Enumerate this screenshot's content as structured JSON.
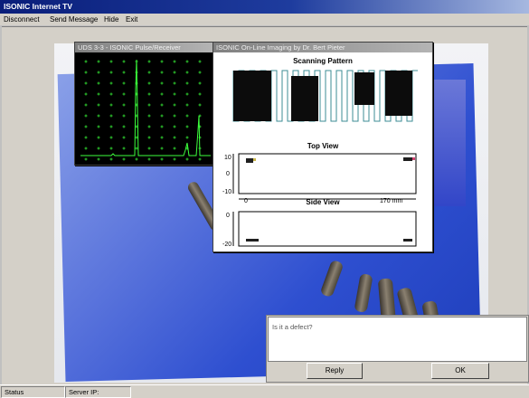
{
  "window": {
    "title": "ISONIC Internet TV"
  },
  "menu": [
    {
      "label": "Disconnect"
    },
    {
      "label": "Send Message"
    },
    {
      "label": "Hide"
    },
    {
      "label": "Exit"
    }
  ],
  "pulse_window": {
    "title": "UDS 3-3 - ISONIC Pulse/Receiver"
  },
  "imaging_window": {
    "title": "ISONIC On-Line Imaging by Dr. Bert Pieter",
    "scanning_pattern_label": "Scanning Pattern",
    "top_view_label": "Top View",
    "side_view_label": "Side View",
    "top_view_ticks": [
      "10",
      "0",
      "-10"
    ],
    "side_axis": {
      "start": "0",
      "end": "170 mm"
    },
    "side_view_ticks": [
      "0",
      "-20"
    ]
  },
  "chat": {
    "message": "Is it a defect?",
    "reply_label": "Reply",
    "ok_label": "OK"
  },
  "status_bar": {
    "status_label": "Status",
    "server_label": "Server IP:"
  },
  "colors": {
    "title_bar": "#0a1e7a",
    "scope_background": "#000000",
    "scope_grid": "#2ecc2e",
    "face": "#d4d0c8"
  }
}
